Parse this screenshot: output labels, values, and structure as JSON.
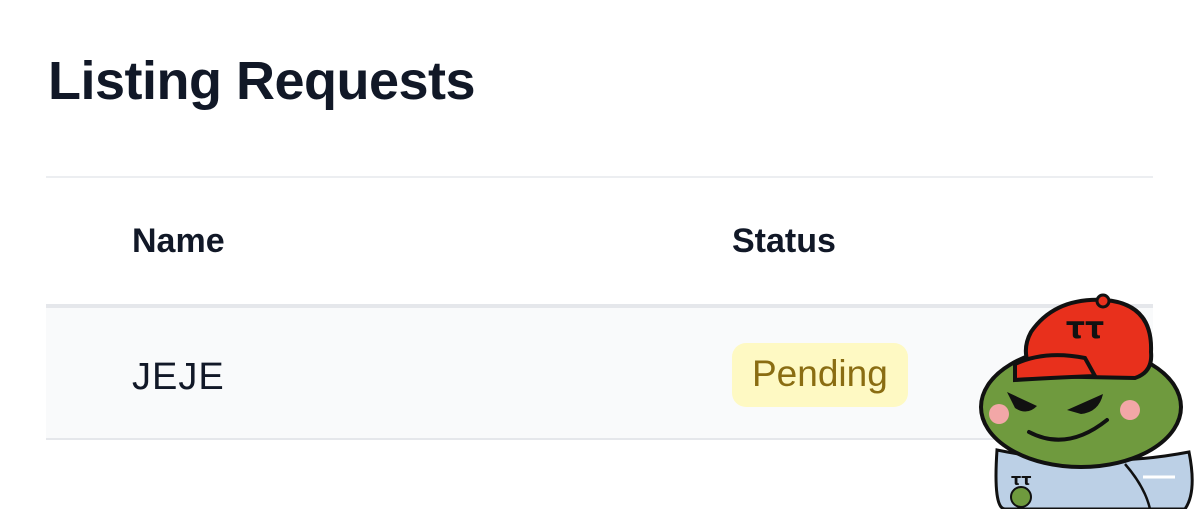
{
  "page": {
    "title": "Listing Requests"
  },
  "table": {
    "headers": {
      "name": "Name",
      "status": "Status"
    },
    "rows": [
      {
        "name": "JEJE",
        "status": "Pending"
      }
    ]
  },
  "sticker": {
    "cap_text": "ττ",
    "pin_text": "ττ"
  },
  "colors": {
    "title_text": "#111827",
    "badge_bg": "#fef9c3",
    "badge_text": "#8a6d12",
    "row_bg": "#f9fafb",
    "cap_red": "#e8301c",
    "frog_green": "#6f9a3e",
    "jacket_blue": "#bcd0e6"
  }
}
